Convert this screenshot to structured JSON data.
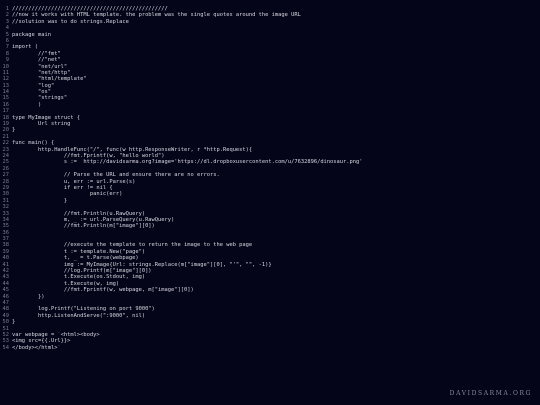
{
  "editor": {
    "lines": [
      "////////////////////////////////////////////////",
      "//now it works with HTML template. the problem was the single quotes around the image URL",
      "//solution was to do strings.Replace",
      "",
      "package main",
      "",
      "import (",
      "        //\"fmt\"",
      "        //\"net\"",
      "        \"net/url\"",
      "        \"net/http\"",
      "        \"html/template\"",
      "        \"log\"",
      "        \"os\"",
      "        \"strings\"",
      "        )",
      "",
      "type MyImage struct {",
      "        Url string",
      "}",
      "",
      "func main() {",
      "        http.HandleFunc(\"/\", func(w http.ResponseWriter, r *http.Request){",
      "                //fmt.Fprintf(w, \"hello world\")",
      "                s :=  http://davidsarma.org?image='https://dl.dropboxusercontent.com/u/7632896/dinosaur.png'",
      "",
      "                // Parse the URL and ensure there are no errors.",
      "                u, err := url.Parse(s)",
      "                if err != nil {",
      "                        panic(err)",
      "                }",
      "",
      "                //fmt.Println(u.RawQuery)",
      "                m, _ := url.ParseQuery(u.RawQuery)",
      "                //fmt.Println(m[\"image\"][0])",
      "",
      "",
      "                //execute the template to return the image to the web page",
      "                t := template.New(\"page\")",
      "                t, _ = t.Parse(webpage)",
      "                img := MyImage{Url: strings.Replace(m[\"image\"][0], \"'\", \"\", -1)}",
      "                //log.Printf(m[\"image\"][0])",
      "                t.Execute(os.Stdout, img)",
      "                t.Execute(w, img)",
      "                //fmt.Fprintf(w, webpage, m[\"image\"][0])",
      "        })",
      "",
      "        log.Printf(\"Listening on port 9000\")",
      "        http.ListenAndServe(\":9000\", nil)",
      "}",
      "",
      "var webpage = `<html><body>",
      "<img src={{.Url}}>",
      "</body></html>`"
    ]
  },
  "watermark": "DAVIDSARMA.ORG"
}
